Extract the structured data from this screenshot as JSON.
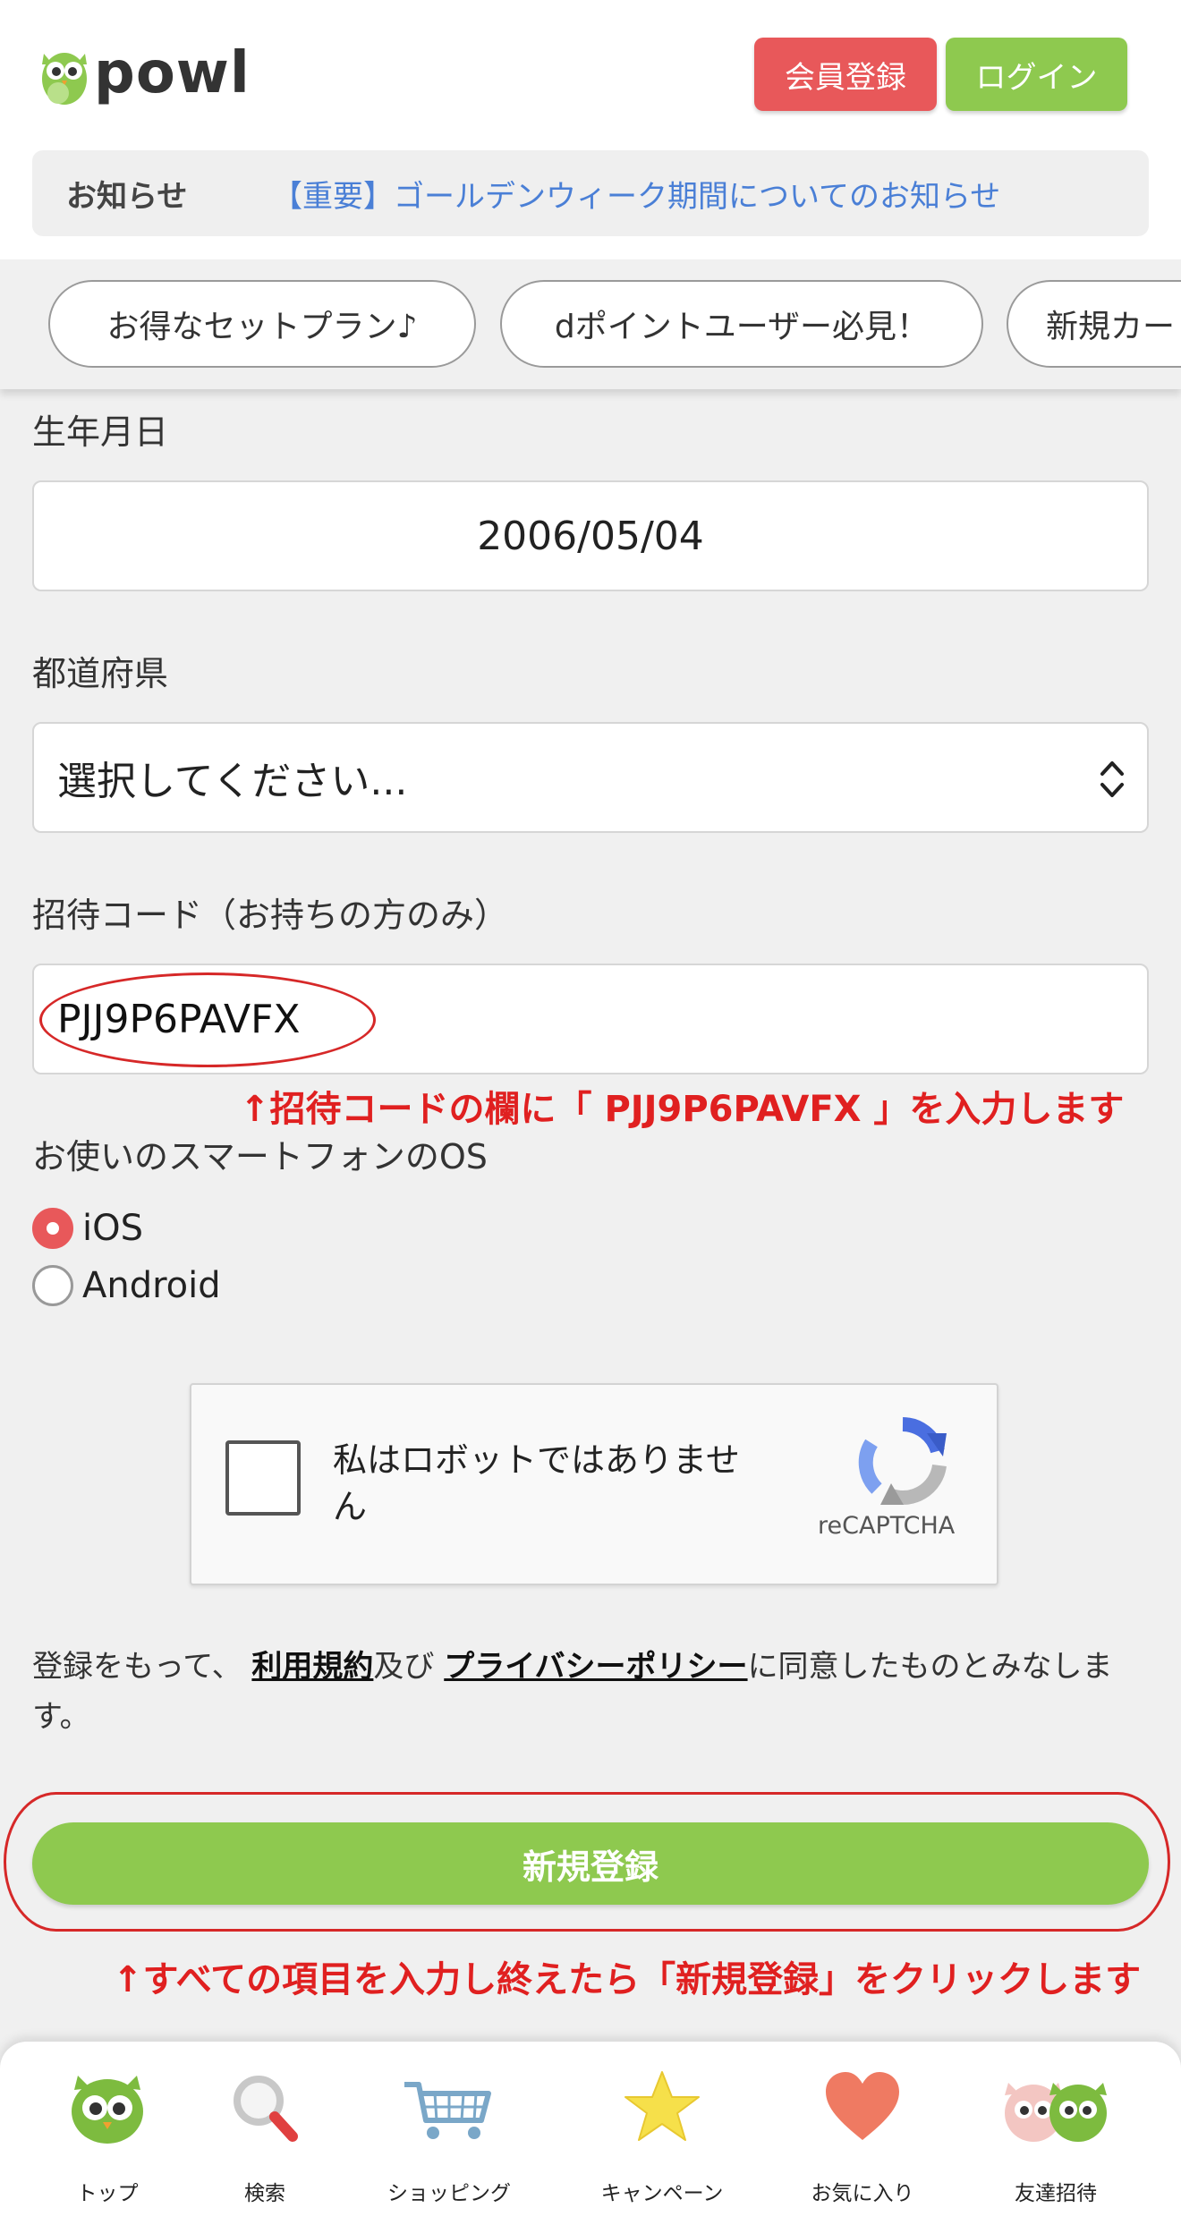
{
  "header": {
    "logo_text": "powl",
    "register_label": "会員登録",
    "login_label": "ログイン"
  },
  "notice": {
    "label": "お知らせ",
    "link_text": "【重要】ゴールデンウィーク期間についてのお知らせ"
  },
  "campaign_chips": [
    "お得なセットプラン♪",
    "dポイントユーザー必見！",
    "新規カー"
  ],
  "form": {
    "birthdate": {
      "label": "生年月日",
      "value": "2006/05/04"
    },
    "prefecture": {
      "label": "都道府県",
      "value": "選択してください..."
    },
    "invite_code": {
      "label": "招待コード（お持ちの方のみ）",
      "value": "PJJ9P6PAVFX"
    },
    "os": {
      "label": "お使いのスマートフォンのOS",
      "options": [
        "iOS",
        "Android"
      ],
      "selected": "iOS"
    },
    "captcha": {
      "text": "私はロボットではありません",
      "brand": "reCAPTCHA"
    },
    "terms": {
      "prefix": "登録をもって、",
      "terms_link": "利用規約",
      "conj": "及び",
      "privacy_link": "プライバシーポリシー",
      "suffix": "に同意したものとみなします。"
    },
    "submit_label": "新規登録"
  },
  "annotations": {
    "invite_note": "↑招待コードの欄に「 PJJ9P6PAVFX 」を入力します",
    "submit_note": "↑すべての項目を入力し終えたら「新規登録」をクリックします"
  },
  "bottom_nav": [
    {
      "label": "トップ",
      "icon": "owl-icon"
    },
    {
      "label": "検索",
      "icon": "search-icon"
    },
    {
      "label": "ショッピング",
      "icon": "cart-icon"
    },
    {
      "label": "キャンペーン",
      "icon": "star-icon"
    },
    {
      "label": "お気に入り",
      "icon": "heart-icon"
    },
    {
      "label": "友達招待",
      "icon": "owls-pair-icon"
    }
  ],
  "colors": {
    "accent_green": "#8ec94f",
    "accent_red": "#e8585a",
    "annotation_red": "#e02020",
    "link_blue": "#4a7fd6"
  }
}
